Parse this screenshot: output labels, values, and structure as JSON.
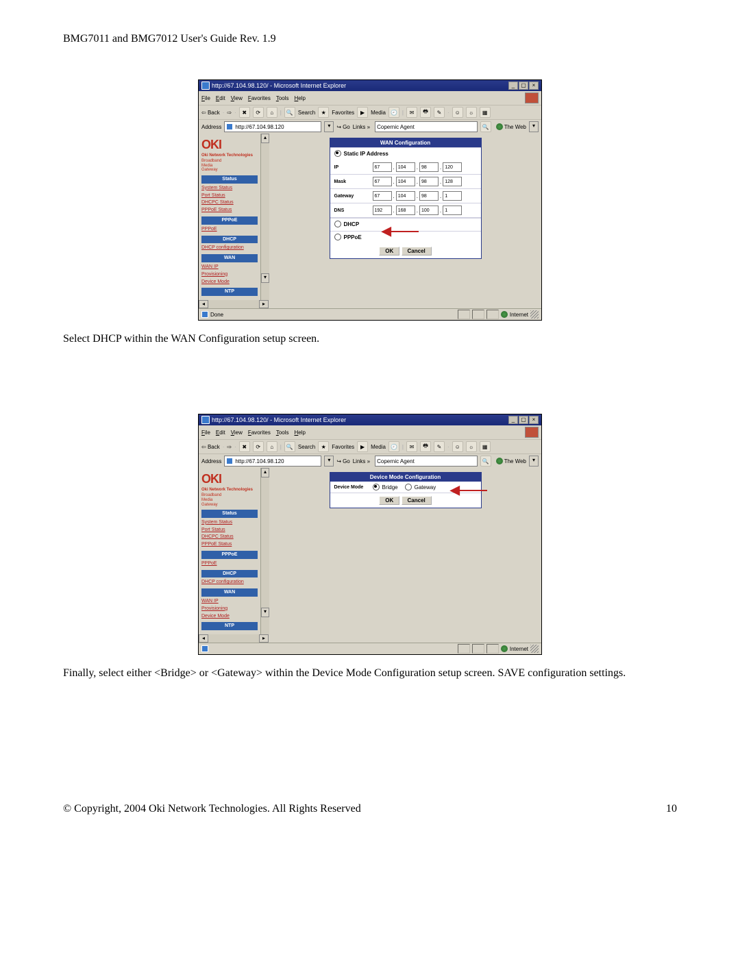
{
  "doc": {
    "header": "BMG7011 and BMG7012 User's Guide Rev. 1.9",
    "caption1": "Select DHCP within the WAN Configuration setup screen.",
    "caption2": "Finally, select either <Bridge> or <Gateway> within the Device Mode Configuration setup screen. SAVE configuration settings.",
    "footer_left": "© Copyright, 2004 Oki Network Technologies. All Rights Reserved",
    "footer_right": "10"
  },
  "shot1": {
    "title": "http://67.104.98.120/ - Microsoft Internet Explorer",
    "menu": [
      "File",
      "Edit",
      "View",
      "Favorites",
      "Tools",
      "Help"
    ],
    "toolbar": {
      "back": "Back",
      "search": "Search",
      "favorites": "Favorites",
      "media": "Media"
    },
    "address_label": "Address",
    "url": "http://67.104.98.120",
    "go": "Go",
    "links": "Links »",
    "copernic": "Copernic Agent",
    "the_web": "The Web",
    "sidebar": {
      "logo": "OKI",
      "logo_sub": "Oki Network Technologies",
      "tag": "Broadband\nMedia\nGateway",
      "groups": [
        {
          "bar": "Status",
          "links": [
            "System Status",
            "Port Status",
            "DHCPC Status",
            "PPPoE Status"
          ]
        },
        {
          "bar": "PPPoE",
          "links": [
            "PPPoE"
          ]
        },
        {
          "bar": "DHCP",
          "links": [
            "DHCP configuration"
          ]
        },
        {
          "bar": "WAN",
          "links": [
            "WAN IP",
            "Provisioning",
            "Device Mode"
          ]
        },
        {
          "bar": "NTP",
          "links": []
        }
      ]
    },
    "panel": {
      "title": "WAN Configuration",
      "static_label": "Static IP Address",
      "rows": [
        {
          "label": "IP",
          "oct": [
            "67",
            "104",
            "98",
            "120"
          ]
        },
        {
          "label": "Mask",
          "oct": [
            "67",
            "104",
            "98",
            "128"
          ]
        },
        {
          "label": "Gateway",
          "oct": [
            "67",
            "104",
            "98",
            "1"
          ]
        },
        {
          "label": "DNS",
          "oct": [
            "192",
            "168",
            "100",
            "1"
          ]
        }
      ],
      "dhcp": "DHCP",
      "pppoe": "PPPoE",
      "ok": "OK",
      "cancel": "Cancel"
    },
    "status": {
      "done": "Done",
      "internet": "Internet"
    }
  },
  "shot2": {
    "title": "http://67.104.98.120/ - Microsoft Internet Explorer",
    "menu": [
      "File",
      "Edit",
      "View",
      "Favorites",
      "Tools",
      "Help"
    ],
    "toolbar": {
      "back": "Back",
      "search": "Search",
      "favorites": "Favorites",
      "media": "Media"
    },
    "address_label": "Address",
    "url": "http://67.104.98.120",
    "go": "Go",
    "links": "Links »",
    "copernic": "Copernic Agent",
    "the_web": "The Web",
    "sidebar": {
      "logo": "OKI",
      "logo_sub": "Oki Network Technologies",
      "tag": "Broadband\nMedia\nGateway",
      "groups": [
        {
          "bar": "Status",
          "links": [
            "System Status",
            "Port Status",
            "DHCPC Status",
            "PPPoE Status"
          ]
        },
        {
          "bar": "PPPoE",
          "links": [
            "PPPoE"
          ]
        },
        {
          "bar": "DHCP",
          "links": [
            "DHCP configuration"
          ]
        },
        {
          "bar": "WAN",
          "links": [
            "WAN IP",
            "Provisioning",
            "Device Mode"
          ]
        },
        {
          "bar": "NTP",
          "links": []
        }
      ]
    },
    "panel": {
      "title": "Device Mode Configuration",
      "row_label": "Device Mode",
      "bridge": "Bridge",
      "gateway": "Gateway",
      "ok": "OK",
      "cancel": "Cancel"
    },
    "status": {
      "done": "",
      "internet": "Internet"
    }
  }
}
